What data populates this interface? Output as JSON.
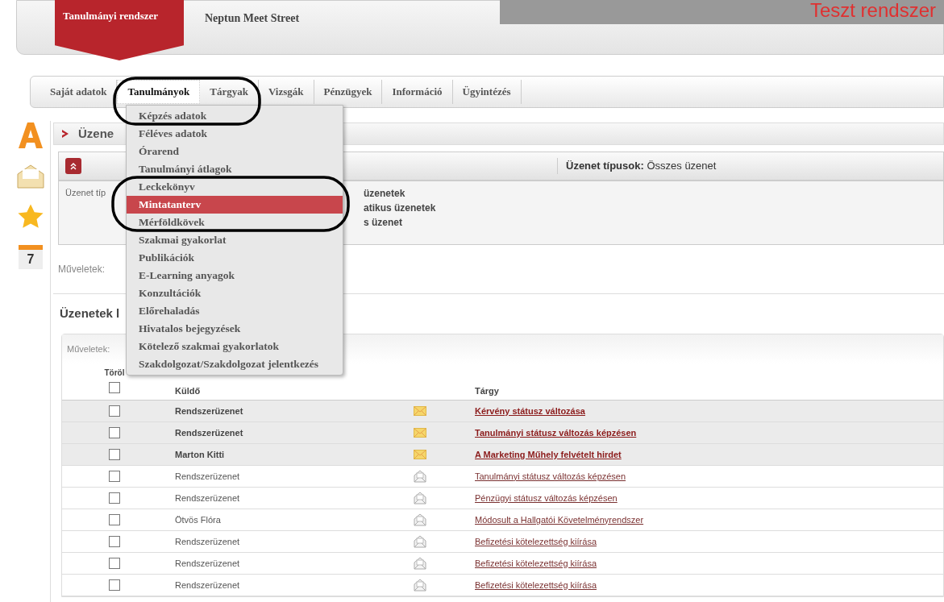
{
  "header": {
    "system_name": "Tanulmányi rendszer",
    "site_name": "Neptun Meet Street",
    "banner": "Teszt rendszer"
  },
  "tabs": [
    {
      "label": "Saját adatok",
      "selected": false
    },
    {
      "label": "Tanulmányok",
      "selected": true
    },
    {
      "label": "Tárgyak",
      "selected": false
    },
    {
      "label": "Vizsgák",
      "selected": false
    },
    {
      "label": "Pénzügyek",
      "selected": false
    },
    {
      "label": "Információ",
      "selected": false
    },
    {
      "label": "Ügyintézés",
      "selected": false
    }
  ],
  "dropdown_menu": [
    {
      "label": "Képzés adatok",
      "selected": false
    },
    {
      "label": "Féléves adatok",
      "selected": false
    },
    {
      "label": "Órarend",
      "selected": false
    },
    {
      "label": "Tanulmányi átlagok",
      "selected": false
    },
    {
      "label": "Leckekönyv",
      "selected": false
    },
    {
      "label": "Mintatanterv",
      "selected": true
    },
    {
      "label": "Mérföldkövek",
      "selected": false
    },
    {
      "label": "Szakmai gyakorlat",
      "selected": false
    },
    {
      "label": "Publikációk",
      "selected": false
    },
    {
      "label": "E-Learning anyagok",
      "selected": false
    },
    {
      "label": "Konzultációk",
      "selected": false
    },
    {
      "label": "Előrehaladás",
      "selected": false
    },
    {
      "label": "Hivatalos bejegyzések",
      "selected": false
    },
    {
      "label": "Kötelező szakmai gyakorlatok",
      "selected": false
    },
    {
      "label": "Szakdolgozat/Szakdolgozat jelentkezés",
      "selected": false
    }
  ],
  "sidebar": {
    "calendar_day": "7"
  },
  "page_title": "Üzene",
  "filter": {
    "type_label": "Üzenet típusok:",
    "type_value": "Összes üzenet",
    "left_fragment": "Üzenet típ",
    "options": [
      "üzenetek",
      "atikus üzenetek",
      "s üzenet"
    ]
  },
  "actions_label": "Műveletek:",
  "list_title": "Üzenetek l",
  "table": {
    "actions_label": "Műveletek:",
    "select_all_checked": false,
    "columns": {
      "delete": "Töröl",
      "sender": "Küldő",
      "subject": "Tárgy"
    },
    "rows": [
      {
        "sender": "Rendszerüzenet",
        "subject": "Kérvény státusz változása",
        "unread": true,
        "checked": false
      },
      {
        "sender": "Rendszerüzenet",
        "subject": "Tanulmányi státusz változás képzésen",
        "unread": true,
        "checked": false
      },
      {
        "sender": "Marton Kitti",
        "subject": "A Marketing Műhely felvételt hirdet",
        "unread": true,
        "checked": false
      },
      {
        "sender": "Rendszerüzenet",
        "subject": "Tanulmányi státusz változás képzésen",
        "unread": false,
        "checked": false
      },
      {
        "sender": "Rendszerüzenet",
        "subject": "Pénzügyi státusz változás képzésen",
        "unread": false,
        "checked": false
      },
      {
        "sender": "Ötvös Flóra",
        "subject": "Módosult a Hallgatói Követelményrendszer",
        "unread": false,
        "checked": false
      },
      {
        "sender": "Rendszerüzenet",
        "subject": "Befizetési kötelezettség kiírása",
        "unread": false,
        "checked": false
      },
      {
        "sender": "Rendszerüzenet",
        "subject": "Befizetési kötelezettség kiírása",
        "unread": false,
        "checked": false
      },
      {
        "sender": "Rendszerüzenet",
        "subject": "Befizetési kötelezettség kiírása",
        "unread": false,
        "checked": false
      }
    ]
  }
}
